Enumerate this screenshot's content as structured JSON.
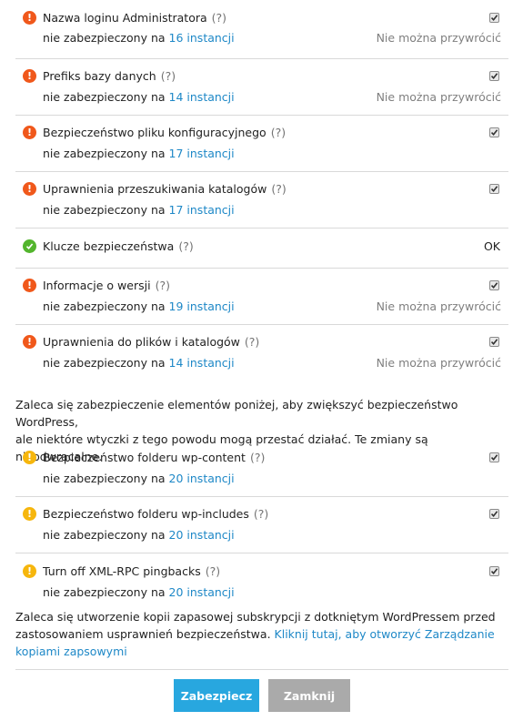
{
  "items": [
    {
      "icon": "error",
      "title": "Nazwa loginu Administratora",
      "help": "(?)",
      "status_prefix": "nie zabezpieczony na",
      "instances": "16 instancji",
      "restore": "Nie można przywrócić",
      "checked": true
    },
    {
      "icon": "error",
      "title": "Prefiks bazy danych",
      "help": "(?)",
      "status_prefix": "nie zabezpieczony na",
      "instances": "14 instancji",
      "restore": "Nie można przywrócić",
      "checked": true
    },
    {
      "icon": "error",
      "title": "Bezpieczeństwo pliku konfiguracyjnego",
      "help": "(?)",
      "status_prefix": "nie zabezpieczony na",
      "instances": "17 instancji",
      "restore": "",
      "checked": true
    },
    {
      "icon": "error",
      "title": "Uprawnienia przeszukiwania katalogów",
      "help": "(?)",
      "status_prefix": "nie zabezpieczony na",
      "instances": "17 instancji",
      "restore": "",
      "checked": true
    },
    {
      "icon": "ok",
      "title": "Klucze bezpieczeństwa",
      "help": "(?)",
      "status": "OK"
    },
    {
      "icon": "error",
      "title": "Informacje o wersji",
      "help": "(?)",
      "status_prefix": "nie zabezpieczony na",
      "instances": "19 instancji",
      "restore": "Nie można przywrócić",
      "checked": true
    },
    {
      "icon": "error",
      "title": "Uprawnienia do plików i katalogów",
      "help": "(?)",
      "status_prefix": "nie zabezpieczony na",
      "instances": "14 instancji",
      "restore": "Nie można przywrócić",
      "checked": true
    }
  ],
  "recommend_text_line1": "Zaleca się zabezpieczenie elementów poniżej, aby zwiększyć bezpieczeństwo WordPress,",
  "recommend_text_line2": "ale niektóre wtyczki z tego powodu mogą przestać działać. Te zmiany są nieodwracalne.",
  "warn_items": [
    {
      "icon": "warning",
      "title": "Bezpieczeństwo folderu wp-content",
      "help": "(?)",
      "status_prefix": "nie zabezpieczony na",
      "instances": "20 instancji",
      "checked": true
    },
    {
      "icon": "warning",
      "title": "Bezpieczeństwo folderu wp-includes",
      "help": "(?)",
      "status_prefix": "nie zabezpieczony na",
      "instances": "20 instancji",
      "checked": true
    },
    {
      "icon": "warning",
      "title": "Turn off XML-RPC pingbacks",
      "help": "(?)",
      "status_prefix": "nie zabezpieczony na",
      "instances": "20 instancji",
      "checked": true
    }
  ],
  "backup_text_line1": "Zaleca się utworzenie kopii zapasowej subskrypcji z dotkniętym WordPressem przed",
  "backup_text_line2": "zastosowaniem usprawnień bezpieczeństwa.",
  "backup_link_line2": "Kliknij tutaj, aby otworzyć Zarządzanie",
  "backup_link_line3": "kopiami zapsowymi",
  "buttons": {
    "secure": "Zabezpiecz",
    "close": "Zamknij"
  },
  "colors": {
    "error": "#f0581b",
    "warning": "#f6b60d",
    "ok": "#53b52d",
    "link": "#1e88c7",
    "primary_button": "#28a7df",
    "secondary_button": "#aaaaaa"
  }
}
